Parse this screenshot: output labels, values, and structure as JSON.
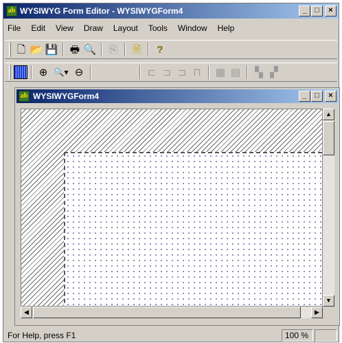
{
  "app": {
    "title": "WYSIWYG Form Editor - WYSIWYGForm4",
    "icon_label": "ab",
    "buttons": {
      "minimize": "_",
      "maximize": "□",
      "close": "×"
    }
  },
  "menu": [
    "File",
    "Edit",
    "View",
    "Draw",
    "Layout",
    "Tools",
    "Window",
    "Help"
  ],
  "toolbar1": {
    "new": "🗋",
    "open": "📂",
    "save": "💾",
    "print": "🖶",
    "print_preview": "🔍",
    "form_properties": "⎘",
    "yellow_page": "🗎",
    "help": "?"
  },
  "toolbar2": {
    "grid": "",
    "zoom_in": "⊕",
    "zoom_dropdown": "🔍▾",
    "zoom_out": "⊖",
    "align_left": "⊏",
    "align_center": "⊐",
    "align_right": "⊐",
    "align_top": "⊓",
    "same_size": "▦",
    "same_width": "▤",
    "bring_front": "▚",
    "send_back": "▞"
  },
  "child": {
    "title": "WYSIWYGForm4",
    "icon_label": "ab"
  },
  "status": {
    "help_text": "For Help, press F1",
    "zoom": "100 %"
  },
  "colors": {
    "titlebar_start": "#0a246a",
    "titlebar_end": "#a6caf0",
    "chrome": "#d4d0c8"
  }
}
